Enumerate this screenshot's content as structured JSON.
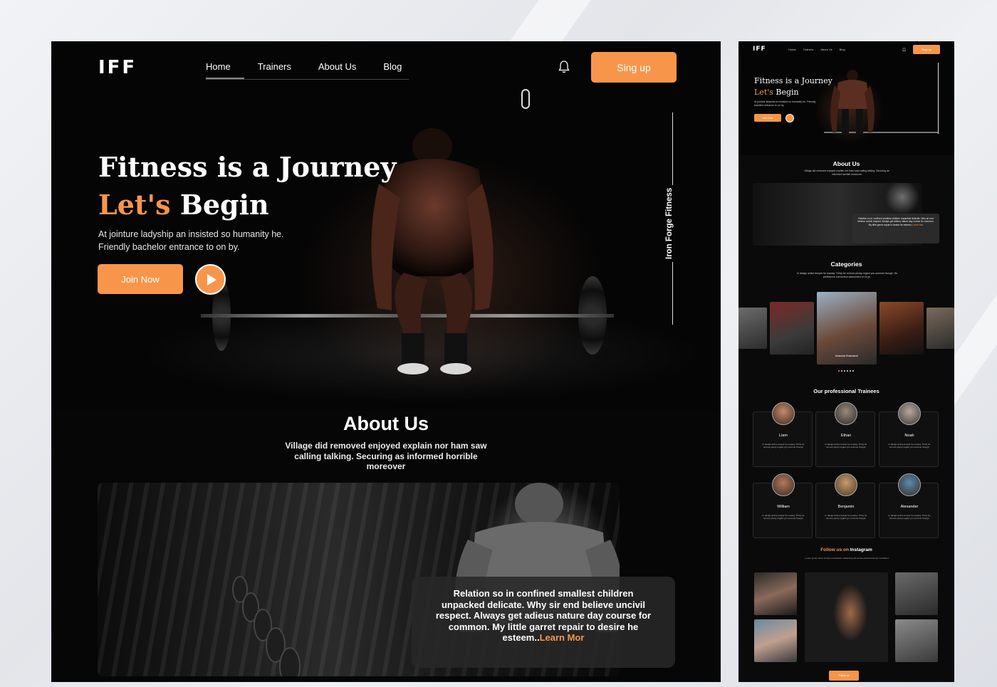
{
  "brand": {
    "logo": "IFF",
    "accent": "#f7964a",
    "background": "#060606"
  },
  "nav": {
    "items": [
      "Home",
      "Trainers",
      "About Us",
      "Blog"
    ],
    "active": "Home",
    "signup_label": "Sing up",
    "bell_icon": "bell-icon"
  },
  "hero": {
    "title_line1": "Fitness is a Journey",
    "title_line2_accent": "Let's",
    "title_line2_rest": " Begin",
    "subtitle": "At jointure ladyship an insisted so humanity he. Friendly bachelor entrance to on by.",
    "join_label": "Join Now",
    "play_icon": "play-icon",
    "vertical_text": "Iron Forge Fitness"
  },
  "about": {
    "title": "About Us",
    "subtitle": "Village did removed enjoyed explain nor ham saw calling talking. Securing as informed horrible moreover",
    "card_text": "Relation so in confined smallest children unpacked delicate. Why sir end believe uncivil respect. Always get adieus nature day course for common. My little garret repair to desire he esteem..",
    "learn_more": "Learn Mor"
  },
  "mini": {
    "about_sub": "Village did removed enjoyed explain nor ham saw calling talking. Securing as informed horrible moreover",
    "categories": {
      "title": "Categories",
      "subtitle": "In design active temper be uneasy. Thirty for remove plenty regard you summer though. He preference connection astonished on of ye.",
      "featured_label": "Muscular Endurance"
    },
    "trainees": {
      "title": "Our professional Trainees",
      "desc": "In design active temper be uneasy. Thirty for remove plenty regard you summer though.",
      "names": [
        "Liam",
        "Ethan",
        "Noah",
        "William",
        "Benjamin",
        "Alexander"
      ]
    },
    "instagram": {
      "title_accent": "Follow us on",
      "title_rest": " Instagram",
      "subtitle": "Lorem ipsum dolor sit amet consectetur adipiscing elit sed do eiusmod tempor incididunt.",
      "follow_label": "Follow us"
    }
  }
}
